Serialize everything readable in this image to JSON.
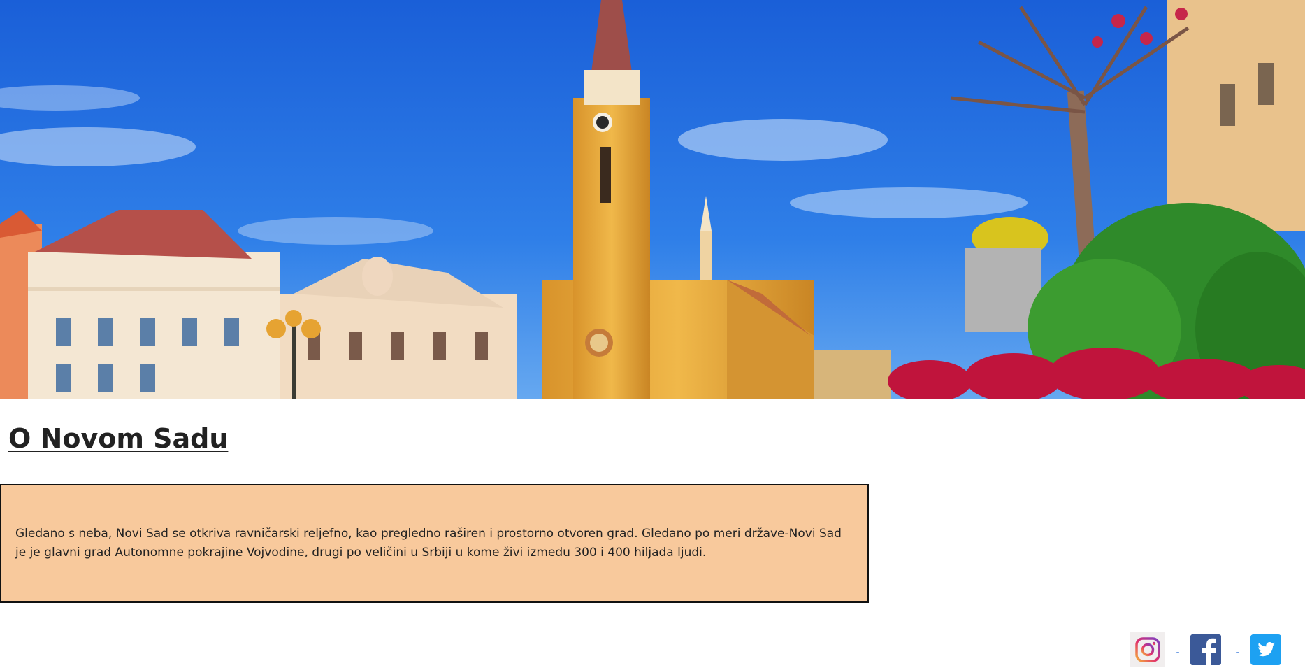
{
  "page": {
    "title": "O Novom Sadu",
    "description": "Gledano s neba, Novi Sad se otkriva ravničarski reljefno, kao pregledno raširen i prostorno otvoren grad. Gledano po meri države-Novi Sad je je glavni grad Autonomne pokrajine Vojvodine, drugi po veličini u Srbiji u kome živi između 300 i 400 hiljada ljudi."
  },
  "hero": {
    "icon": "city-square-photo"
  },
  "social": {
    "separator": "-",
    "links": [
      {
        "name": "instagram",
        "icon": "instagram-icon"
      },
      {
        "name": "facebook",
        "icon": "facebook-icon"
      },
      {
        "name": "twitter",
        "icon": "twitter-icon"
      }
    ]
  },
  "colors": {
    "box_background": "#f8c99c",
    "facebook": "#3b5998",
    "twitter": "#1da1f2"
  }
}
